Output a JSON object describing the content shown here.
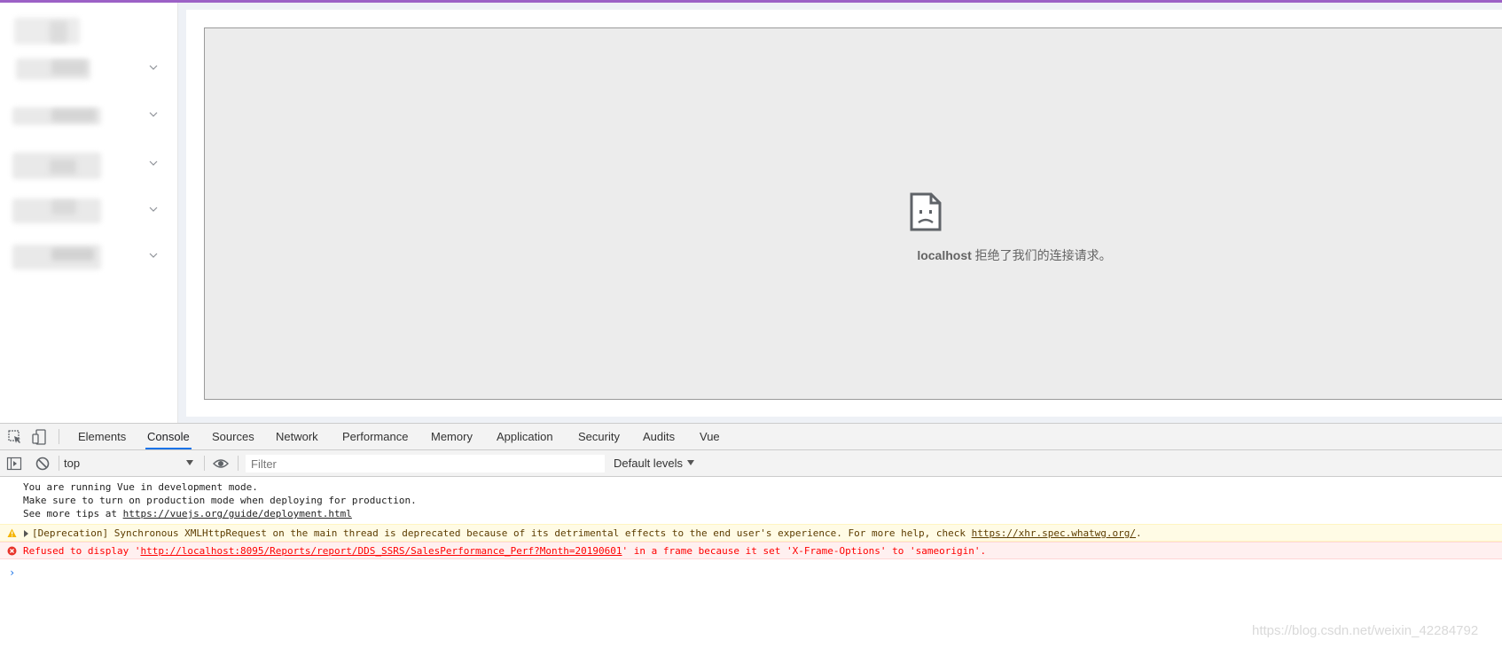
{
  "iframe": {
    "host": "localhost",
    "message": " 拒绝了我们的连接请求。"
  },
  "devtools": {
    "tabs": [
      "Elements",
      "Console",
      "Sources",
      "Network",
      "Performance",
      "Memory",
      "Application",
      "Security",
      "Audits",
      "Vue"
    ],
    "active_tab": "Console",
    "context": "top",
    "filter_placeholder": "Filter",
    "levels": "Default levels"
  },
  "console": {
    "info_line1": "You are running Vue in development mode.",
    "info_line2": "Make sure to turn on production mode when deploying for production.",
    "info_line3_prefix": "See more tips at ",
    "info_link": "https://vuejs.org/guide/deployment.html",
    "warn_prefix": "[Deprecation] Synchronous XMLHttpRequest on the main thread is deprecated because of its detrimental effects to the end user's experience. For more help, check ",
    "warn_link": "https://xhr.spec.whatwg.org/",
    "warn_suffix": ".",
    "error_prefix": "Refused to display '",
    "error_link": "http://localhost:8095/Reports/report/DDS_SSRS/SalesPerformance_Perf?Month=20190601",
    "error_suffix": "' in a frame because it set 'X-Frame-Options' to 'sameorigin'.",
    "prompt": "›"
  },
  "watermark": "https://blog.csdn.net/weixin_42284792",
  "icons": {
    "sad_page": "sad-page-icon",
    "inspect": "inspect-element-icon",
    "device": "device-toolbar-icon",
    "sidebar_toggle": "console-sidebar-icon",
    "clear": "clear-console-icon",
    "eye": "live-expression-icon",
    "warning": "warning-icon",
    "error": "error-icon"
  },
  "colors": {
    "accent": "#1a73e8",
    "top_bar": "#9c61c6",
    "warning_bg": "#fffbe5",
    "error_text": "#ff0000",
    "error_bg": "#fff0f0"
  }
}
